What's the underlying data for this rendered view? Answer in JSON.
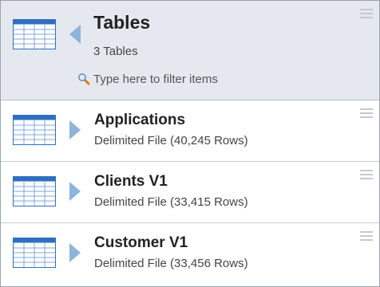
{
  "header": {
    "title": "Tables",
    "count": "3 Tables",
    "filter_placeholder": "Type here to filter items"
  },
  "items": [
    {
      "name": "Applications",
      "type": "Delimited File",
      "rows": "(40,245 Rows)"
    },
    {
      "name": "Clients V1",
      "type": "Delimited File",
      "rows": "(33,415 Rows)"
    },
    {
      "name": "Customer V1",
      "type": "Delimited File",
      "rows": "(33,456 Rows)"
    }
  ],
  "colors": {
    "header_bg": "#e5e8ef",
    "table_icon_blue": "#2f6fbf",
    "arrow_blue": "#8db4da"
  },
  "icons": [
    "table-icon",
    "collapse-arrow-icon",
    "expand-arrow-icon",
    "search-icon",
    "menu-icon"
  ]
}
